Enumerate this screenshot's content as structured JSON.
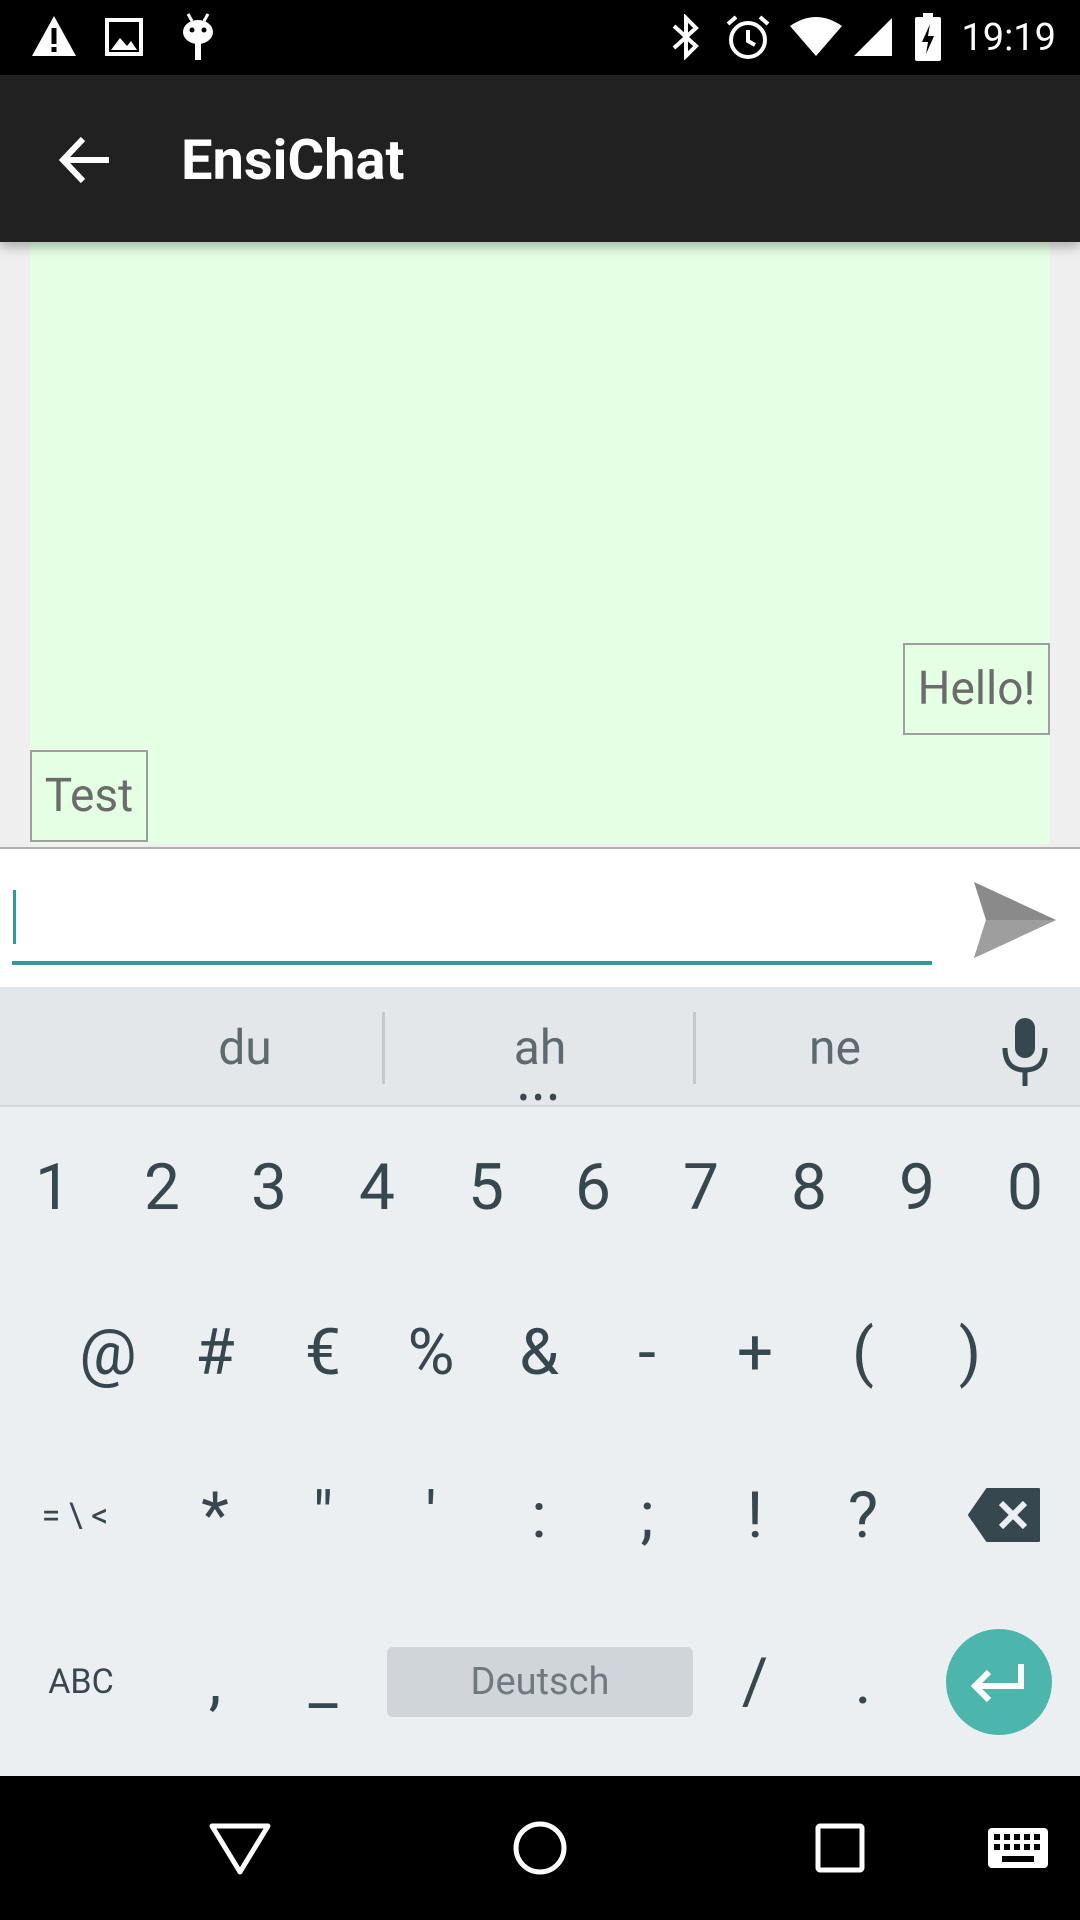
{
  "status_bar": {
    "time": "19:19",
    "left_icons": [
      "warning-icon",
      "image-icon",
      "android-icon"
    ],
    "right_icons": [
      "bluetooth-icon",
      "alarm-icon",
      "wifi-icon",
      "signal-icon",
      "battery-charging-icon"
    ]
  },
  "app_bar": {
    "title": "EnsiChat",
    "back_icon": "arrow-left-icon"
  },
  "chat": {
    "messages": [
      {
        "text": "Hello!",
        "side": "right"
      },
      {
        "text": "Test",
        "side": "left"
      }
    ]
  },
  "composer": {
    "value": "",
    "placeholder": "",
    "send_icon": "send-icon"
  },
  "keyboard": {
    "suggestions": [
      "du",
      "ah",
      "ne"
    ],
    "row1": [
      "1",
      "2",
      "3",
      "4",
      "5",
      "6",
      "7",
      "8",
      "9",
      "0"
    ],
    "row2": [
      "@",
      "#",
      "€",
      "%",
      "&",
      "-",
      "+",
      "(",
      ")"
    ],
    "row3": [
      "= \\ <",
      "*",
      "\"",
      "'",
      ":",
      ";",
      "!",
      "?"
    ],
    "row4": {
      "abc": "ABC",
      "comma": ",",
      "underscore": "_",
      "space": "Deutsch",
      "slash": "/",
      "period": "."
    },
    "colors": {
      "enter": "#4db6ac",
      "background": "#eceff1"
    }
  },
  "nav_bar": {
    "icons": [
      "back-triangle-icon",
      "home-circle-icon",
      "recents-square-icon",
      "keyboard-switch-icon"
    ]
  },
  "colors": {
    "chat_background": "#e4ffe4",
    "accent": "#2e9c94",
    "app_bar": "#212121"
  }
}
